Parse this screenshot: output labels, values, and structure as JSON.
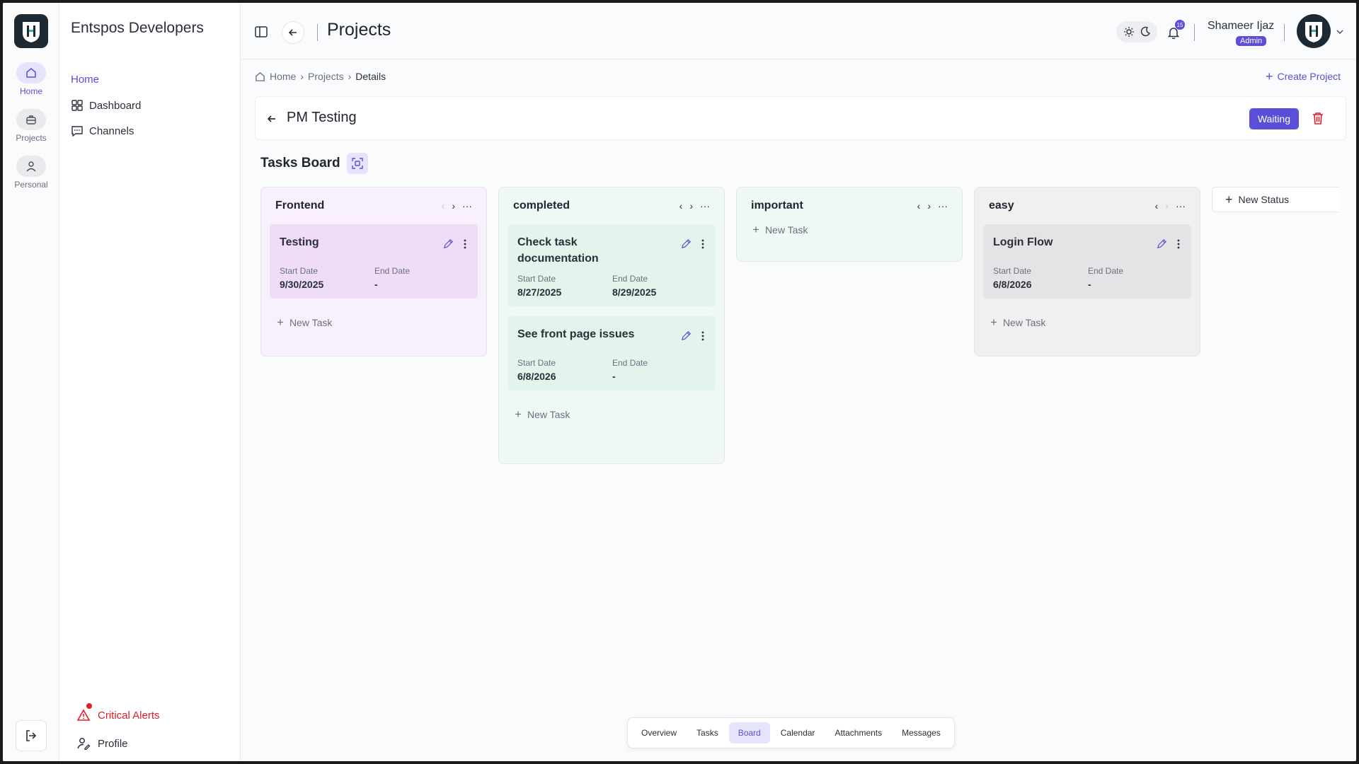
{
  "rail": {
    "items": [
      {
        "label": "Home",
        "icon": "home-icon"
      },
      {
        "label": "Projects",
        "icon": "briefcase-icon"
      },
      {
        "label": "Personal",
        "icon": "user-icon"
      }
    ]
  },
  "sidebar": {
    "org_name": "Entspos Developers",
    "home_label": "Home",
    "dashboard_label": "Dashboard",
    "channels_label": "Channels",
    "critical_alerts_label": "Critical Alerts",
    "profile_label": "Profile"
  },
  "topbar": {
    "title": "Projects",
    "notification_count": "15",
    "user_name": "Shameer Ijaz",
    "user_role": "Admin"
  },
  "breadcrumb": {
    "home": "Home",
    "projects": "Projects",
    "current": "Details"
  },
  "create_project_label": "Create Project",
  "project": {
    "name": "PM Testing",
    "status": "Waiting"
  },
  "board": {
    "title": "Tasks Board",
    "new_status_label": "New Status",
    "new_task_label": "New Task",
    "start_label": "Start Date",
    "end_label": "End Date",
    "columns": [
      {
        "name": "Frontend",
        "tasks": [
          {
            "title": "Testing",
            "start": "9/30/2025",
            "end": "-"
          }
        ]
      },
      {
        "name": "completed",
        "tasks": [
          {
            "title": "Check task documentation",
            "start": "8/27/2025",
            "end": "8/29/2025"
          },
          {
            "title": "See front page issues",
            "start": "6/8/2026",
            "end": "-"
          }
        ]
      },
      {
        "name": "important",
        "tasks": []
      },
      {
        "name": "easy",
        "tasks": [
          {
            "title": "Login Flow",
            "start": "6/8/2026",
            "end": "-"
          }
        ]
      }
    ]
  },
  "tabs": [
    "Overview",
    "Tasks",
    "Board",
    "Calendar",
    "Attachments",
    "Messages"
  ],
  "colors": {
    "accent": "#5a4fd6",
    "danger": "#e11d2a",
    "frontend_col": "#f8f0fd",
    "frontend_card": "#efdcf6",
    "completed_col": "#eff8f4",
    "completed_card": "#e2f4ec",
    "important_col": "#eff8f4",
    "easy_col": "#f0f0f1",
    "easy_card": "#e4e4e6"
  }
}
